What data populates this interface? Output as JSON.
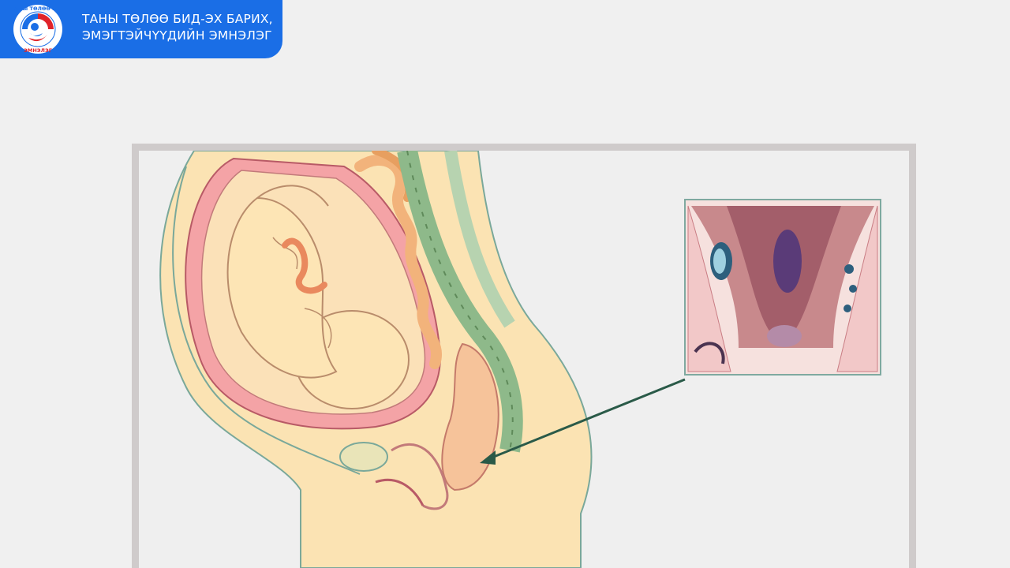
{
  "header": {
    "logo_ring_text": "ТАНЫ ТӨЛӨӨ БИД ЭМНЭЛЭГ",
    "title_line1": "ТАНЫ ТӨЛӨӨ БИД-ЭХ БАРИХ,",
    "title_line2": "ЭМЭГТЭЙЧҮҮДИЙН ЭМНЭЛЭГ"
  },
  "colors": {
    "header_blue": "#1a6ee6",
    "frame_border": "#cfcbcb",
    "background": "#f0f0f0"
  },
  "illustration": {
    "main": "sagittal-pregnancy-anatomy",
    "inset": "hemorrhoids-closeup"
  }
}
